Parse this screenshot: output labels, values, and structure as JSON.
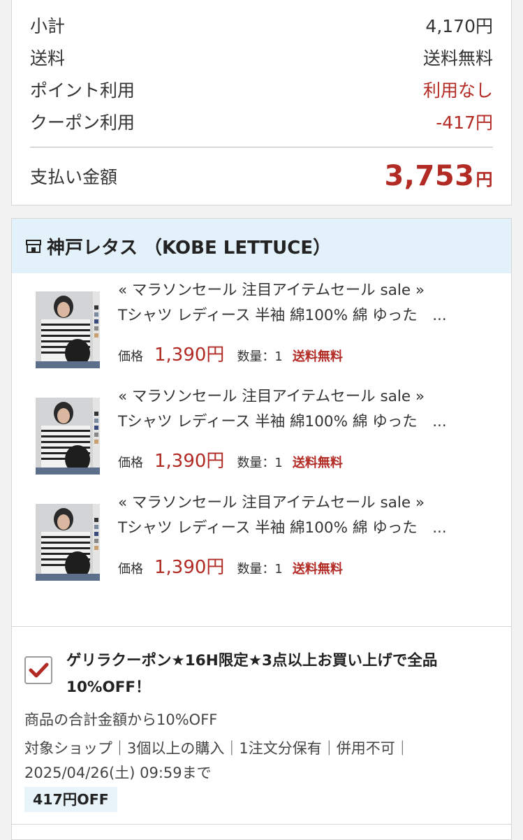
{
  "summary": {
    "subtotal_label": "小計",
    "subtotal_value": "4,170円",
    "shipping_label": "送料",
    "shipping_value": "送料無料",
    "points_label": "ポイント利用",
    "points_value": "利用なし",
    "coupon_label": "クーポン利用",
    "coupon_value": "-417円",
    "total_label": "支払い金額",
    "total_value": "3,753",
    "total_unit": "円"
  },
  "shop": {
    "name": "神戸レタス （KOBE LETTUCE）",
    "icon": "shop-icon",
    "items": [
      {
        "title1": "« マラソンセール 注目アイテムセール sale »",
        "title2": "Tシャツ レディース 半袖 綿100% 綿 ゆった　...",
        "price_label": "価格",
        "price": "1,390円",
        "qty": "数量：1",
        "shipping": "送料無料"
      },
      {
        "title1": "« マラソンセール 注目アイテムセール sale »",
        "title2": "Tシャツ レディース 半袖 綿100% 綿 ゆった　...",
        "price_label": "価格",
        "price": "1,390円",
        "qty": "数量：1",
        "shipping": "送料無料"
      },
      {
        "title1": "« マラソンセール 注目アイテムセール sale »",
        "title2": "Tシャツ レディース 半袖 綿100% 綿 ゆった　...",
        "price_label": "価格",
        "price": "1,390円",
        "qty": "数量：1",
        "shipping": "送料無料"
      }
    ]
  },
  "coupon": {
    "checked": true,
    "title": "ゲリラクーポン★16H限定★3点以上お買い上げで全品10%OFF！",
    "description": "商品の合計金額から10%OFF",
    "conditions": "対象ショップ｜3個以上の購入｜1注文分保有｜併用不可｜2025/04/26(土) 09:59まで",
    "discount": "417円OFF"
  },
  "colors": {
    "accent_red": "#b22a24",
    "header_blue": "#e3f1fa"
  }
}
